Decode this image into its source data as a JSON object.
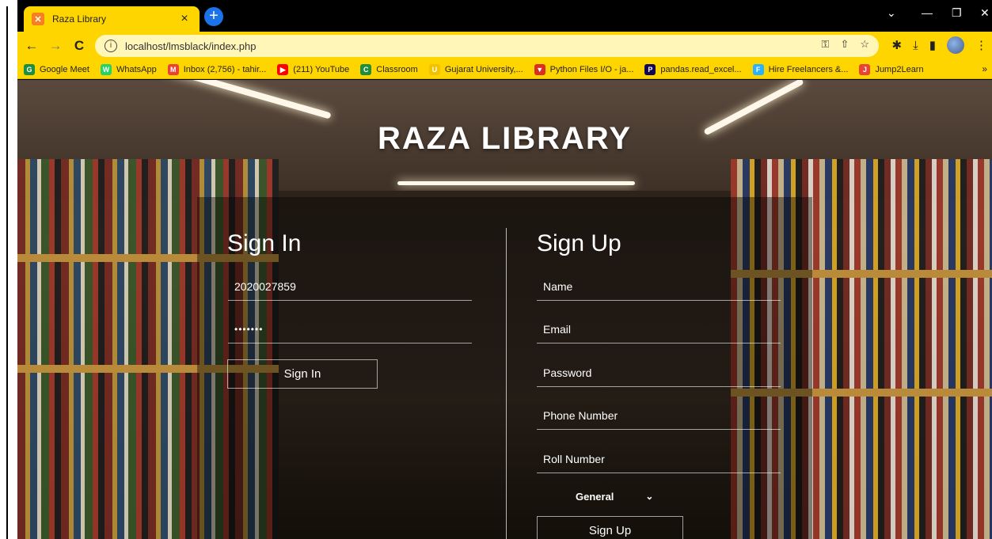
{
  "browser": {
    "tab_title": "Raza Library",
    "tab_close": "×",
    "new_tab": "+",
    "url": "localhost/lmsblack/index.php",
    "bookmarks": [
      {
        "label": "Google Meet",
        "color": "#1e8e3e",
        "icon": "G"
      },
      {
        "label": "WhatsApp",
        "color": "#25d366",
        "icon": "W"
      },
      {
        "label": "Inbox (2,756) - tahir...",
        "color": "#ea4335",
        "icon": "M"
      },
      {
        "label": "(211) YouTube",
        "color": "#ff0000",
        "icon": "▶"
      },
      {
        "label": "Classroom",
        "color": "#1e8e3e",
        "icon": "C"
      },
      {
        "label": "Gujarat University,...",
        "color": "#f2c200",
        "icon": "U"
      },
      {
        "label": "Python Files I/O - ja...",
        "color": "#d93025",
        "icon": "▼"
      },
      {
        "label": "pandas.read_excel...",
        "color": "#130754",
        "icon": "P"
      },
      {
        "label": "Hire Freelancers &...",
        "color": "#29b2fe",
        "icon": "F"
      },
      {
        "label": "Jump2Learn",
        "color": "#ea4335",
        "icon": "J"
      }
    ],
    "bookmarks_more": "»"
  },
  "page": {
    "site_title": "RAZA LIBRARY",
    "signin": {
      "heading": "Sign In",
      "username_value": "2020027859",
      "password_value": "•••••••",
      "button_label": "Sign In"
    },
    "signup": {
      "heading": "Sign Up",
      "name_placeholder": "Name",
      "email_placeholder": "Email",
      "password_placeholder": "Password",
      "phone_placeholder": "Phone Number",
      "roll_placeholder": "Roll Number",
      "category_selected": "General",
      "button_label": "Sign Up"
    }
  }
}
